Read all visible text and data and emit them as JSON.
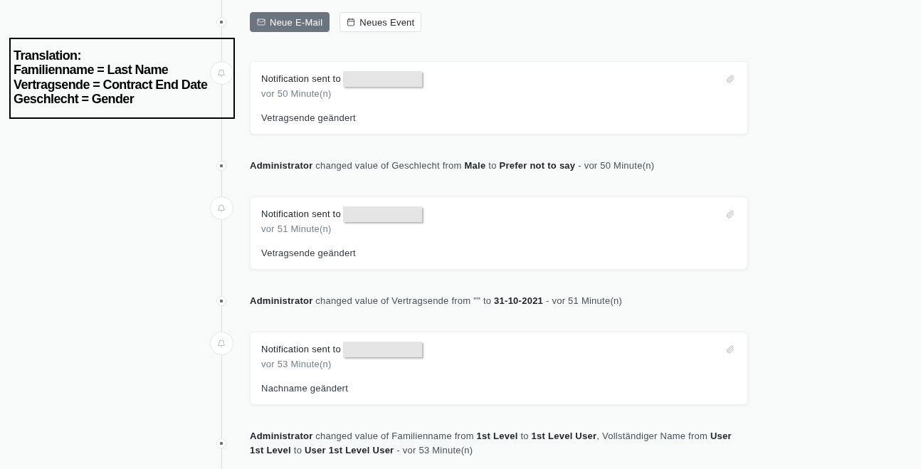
{
  "annotation": {
    "title": "Translation:",
    "lines": [
      "Familienname = Last Name",
      "Vertragsende = Contract End Date",
      "Geschlecht = Gender"
    ]
  },
  "actions": [
    {
      "kind": "email",
      "label": "Neue E-Mail"
    },
    {
      "kind": "event",
      "label": "Neues Event"
    }
  ],
  "timeline": [
    {
      "kind": "notification",
      "title": "Notification sent to",
      "time": "vor 50 Minute(n)",
      "message": "Vetragsende geändert"
    },
    {
      "kind": "change",
      "text": "**Administrator** changed value of Geschlecht from **Male** to **Prefer not to say** - vor 50 Minute(n)"
    },
    {
      "kind": "notification",
      "title": "Notification sent to",
      "time": "vor 51 Minute(n)",
      "message": "Vetragsende geändert"
    },
    {
      "kind": "change",
      "text": "**Administrator** changed value of Vertragsende from \"\" to **31-10-2021** - vor 51 Minute(n)"
    },
    {
      "kind": "notification",
      "title": "Notification sent to",
      "time": "vor 53 Minute(n)",
      "message": "Nachname geändert"
    },
    {
      "kind": "change",
      "text": "**Administrator** changed value of Familienname from **1st Level** to **1st Level User**, Vollständiger Name from **User 1st Level** to **User 1st Level User** - vor 53 Minute(n)"
    }
  ]
}
